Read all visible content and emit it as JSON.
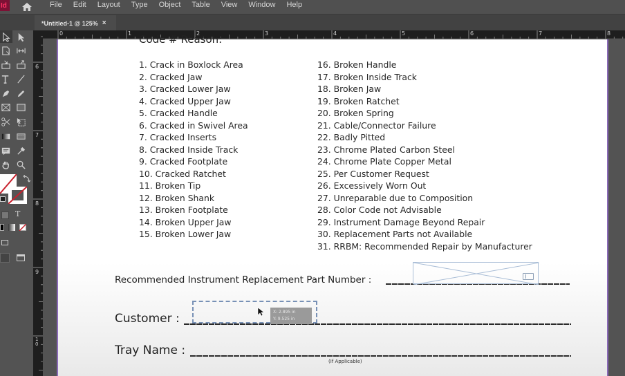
{
  "app": {
    "logo_text": "Id",
    "home_icon": "home-icon",
    "menu": [
      "File",
      "Edit",
      "Layout",
      "Type",
      "Object",
      "Table",
      "View",
      "Window",
      "Help"
    ]
  },
  "document_tab": {
    "title": "*Untitled-1 @ 125%",
    "close_glyph": "×"
  },
  "tools": [
    {
      "name": "selection-tool",
      "icon": "arrow-outline-icon",
      "active": true
    },
    {
      "name": "direct-selection-tool",
      "icon": "arrow-filled-icon"
    },
    {
      "name": "page-tool",
      "icon": "page-icon"
    },
    {
      "name": "gap-tool",
      "icon": "gap-icon"
    },
    {
      "name": "content-collector-tool",
      "icon": "collector-icon"
    },
    {
      "name": "content-placer-tool",
      "icon": "placer-icon"
    },
    {
      "name": "type-tool",
      "icon": "type-icon"
    },
    {
      "name": "line-tool",
      "icon": "line-icon"
    },
    {
      "name": "pen-tool",
      "icon": "pen-icon"
    },
    {
      "name": "pencil-tool",
      "icon": "pencil-icon"
    },
    {
      "name": "rectangle-frame-tool",
      "icon": "rectangle-frame-icon"
    },
    {
      "name": "rectangle-tool",
      "icon": "rectangle-icon"
    },
    {
      "name": "scissors-tool",
      "icon": "scissors-icon"
    },
    {
      "name": "free-transform-tool",
      "icon": "free-transform-icon"
    },
    {
      "name": "gradient-swatch-tool",
      "icon": "gradient-icon"
    },
    {
      "name": "gradient-feather-tool",
      "icon": "gradient-feather-icon"
    },
    {
      "name": "note-tool",
      "icon": "note-icon"
    },
    {
      "name": "eyedropper-tool",
      "icon": "eyedropper-icon"
    },
    {
      "name": "hand-tool",
      "icon": "hand-icon"
    },
    {
      "name": "zoom-tool",
      "icon": "zoom-icon"
    }
  ],
  "rulers": {
    "horizontal": [
      "0",
      "1",
      "2",
      "3",
      "4",
      "5",
      "6",
      "7",
      "8"
    ],
    "vertical": [
      "6",
      "7",
      "8",
      "9",
      "10"
    ]
  },
  "document": {
    "heading": "Code # Reason:",
    "reasons_col1": [
      "1. Crack in Boxlock Area",
      "2. Cracked Jaw",
      "3. Cracked Lower Jaw",
      "4. Cracked Upper Jaw",
      "5. Cracked Handle",
      "6. Cracked in Swivel Area",
      "7. Cracked Inserts",
      "8. Cracked Inside Track",
      "9. Cracked Footplate",
      "10. Cracked Ratchet",
      "11. Broken Tip",
      "12. Broken Shank",
      "13. Broken Footplate",
      "14. Broken Upper Jaw",
      "15. Broken Lower Jaw"
    ],
    "reasons_col2": [
      "16. Broken Handle",
      "17. Broken Inside Track",
      "18. Broken Jaw",
      "19. Broken Ratchet",
      "20. Broken Spring",
      "21. Cable/Connector Failure",
      "22. Badly Pitted",
      "23. Chrome Plated Carbon Steel",
      "24. Chrome Plate Copper Metal",
      "25. Per Customer Request",
      "26. Excessively Worn Out",
      "27. Unreparable due to Composition",
      "28. Color Code not Advisable",
      "29. Instrument Damage Beyond Repair",
      "30. Replacement Parts not Available",
      "31. RRBM: Recommended Repair by Manufacturer"
    ],
    "fields": {
      "part_number_label": "Recommended Instrument Replacement Part Number :",
      "customer_label": "Customer :",
      "tray_name_label": "Tray Name :",
      "tray_name_note": "(If Applicable)"
    }
  },
  "coordinate_tooltip": {
    "x": "X: 2.895 in",
    "y": "Y: 9.525 in"
  },
  "colors": {
    "page_border": "#8b6ab8",
    "frame_stroke": "#a9bdd6",
    "marquee": "#7891b6",
    "app_accent": "#ff3366"
  }
}
